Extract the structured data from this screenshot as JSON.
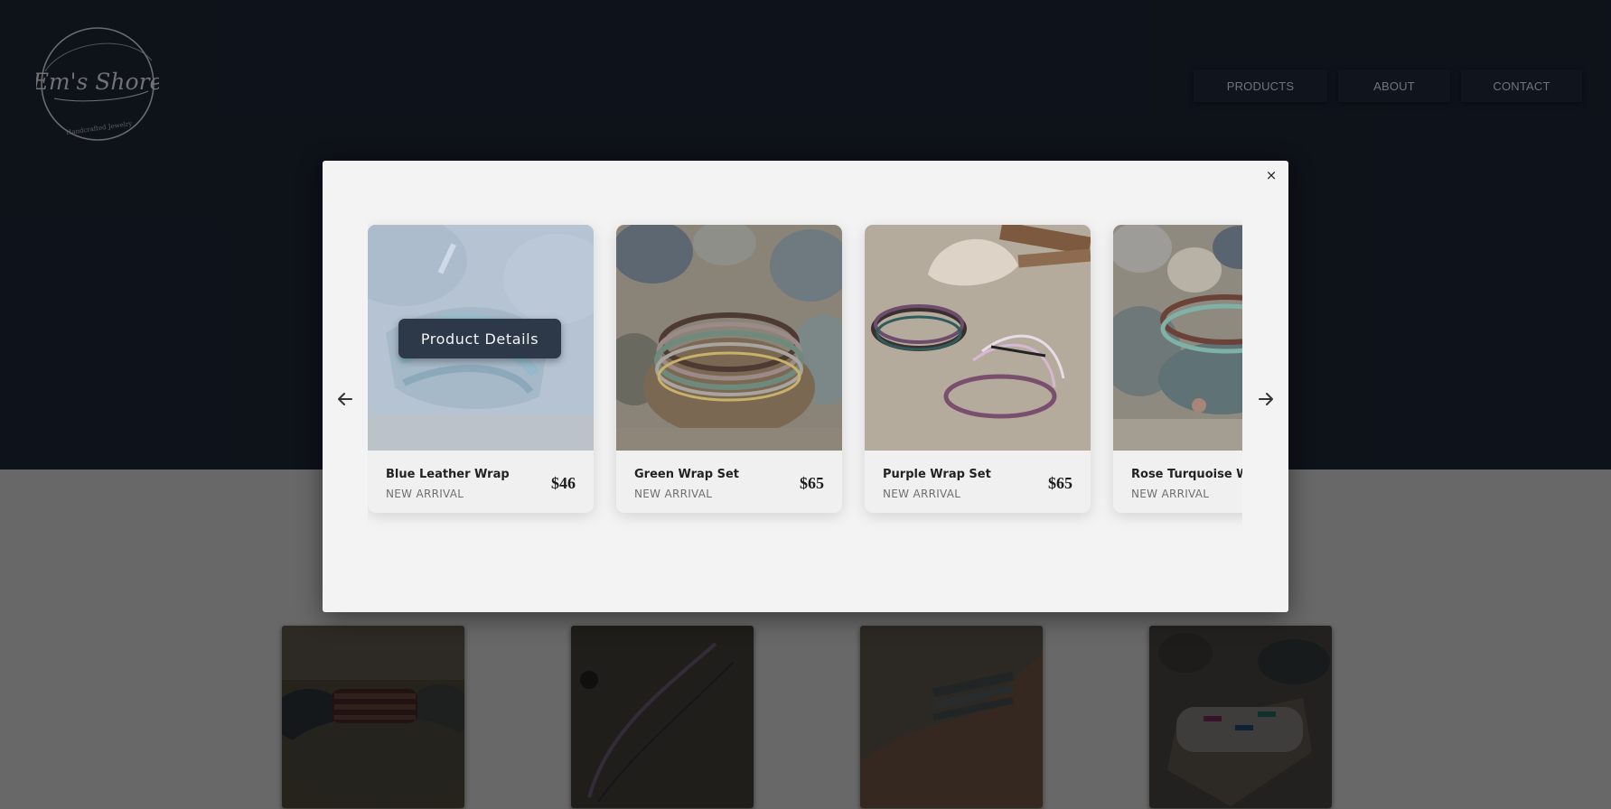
{
  "brand": {
    "logo_text": "Em's Shore",
    "logo_tagline": "Handcrafted Jewelry"
  },
  "nav": {
    "items": [
      {
        "label": "PRODUCTS"
      },
      {
        "label": "ABOUT"
      },
      {
        "label": "CONTACT"
      }
    ]
  },
  "modal": {
    "close_label": "×",
    "details_button": "Product Details",
    "cards": [
      {
        "title": "Blue Leather Wrap",
        "subtitle": "NEW ARRIVAL",
        "price": "$46"
      },
      {
        "title": "Green Wrap Set",
        "subtitle": "NEW ARRIVAL",
        "price": "$65"
      },
      {
        "title": "Purple Wrap Set",
        "subtitle": "NEW ARRIVAL",
        "price": "$65"
      },
      {
        "title": "Rose Turquoise Wrap",
        "subtitle": "NEW ARRIVAL",
        "price": ""
      }
    ]
  },
  "icons": {
    "prev": "arrow-left-icon",
    "next": "arrow-right-icon",
    "close": "close-icon"
  },
  "colors": {
    "header_bg": "#1b2331",
    "button_dark": "#2d3848",
    "modal_bg": "#f3f3f3"
  }
}
